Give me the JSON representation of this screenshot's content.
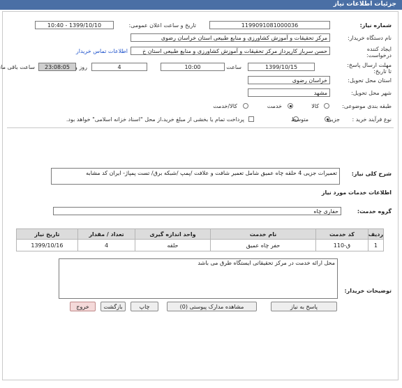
{
  "header": {
    "title": "جزئیات اطلاعات نیاز"
  },
  "need_number": {
    "label": "شماره نیاز:",
    "value": "1199091081000036"
  },
  "announce_datetime": {
    "label": "تاریخ و ساعت اعلان عمومی:",
    "value": "1399/10/10 - 10:40"
  },
  "buyer_org": {
    "label": "نام دستگاه خریدار:",
    "value": "مرکز تحقیقات و آموزش کشاورزی و منابع طبیعی استان خراسان رضوی"
  },
  "requester": {
    "label": "ایجاد کننده درخواست:",
    "value": "حسن  سرباز کارپرداز مرکز تحقیقات و آموزش کشاورزی و منابع طبیعی استان خ",
    "contact_link": "اطلاعات تماس خریدار"
  },
  "deadline": {
    "label": "مهلت ارسال پاسخ: تا تاریخ:",
    "date": "1399/10/15",
    "time_label": "ساعت",
    "time": "10:00",
    "days": "4",
    "days_label": "روز و",
    "remaining": "23:08:05",
    "remaining_label": "ساعت باقی مانده"
  },
  "delivery_province": {
    "label": "استان محل تحویل:",
    "value": "خراسان رضوی"
  },
  "delivery_city": {
    "label": "شهر محل تحویل:",
    "value": "مشهد"
  },
  "category": {
    "label": "طبقه بندی موضوعی:",
    "options": [
      "کالا",
      "خدمت",
      "کالا/خدمت"
    ],
    "selected": "خدمت"
  },
  "purchase_type": {
    "label": "نوع فرآیند خرید :",
    "options": [
      "جزیی",
      "متوسط"
    ],
    "selected": "جزیی",
    "note": "پرداخت تمام یا بخشی از مبلغ خرید،از محل \"اسناد خزانه اسلامی\" خواهد بود."
  },
  "description": {
    "label": "شرح کلی نیاز:",
    "value": "تعمیرات جزیی 4 حلقه چاه عمیق شامل تعمیر شافت و علافت /پمپ /شبکه برق/ تست پمپاژ- ایران کد مشابه"
  },
  "services_info": {
    "title": "اطلاعات خدمات مورد نیاز"
  },
  "service_group": {
    "label": "گروه خدمت:",
    "value": "حفاری چاه"
  },
  "table": {
    "headers": [
      "ردیف",
      "کد خدمت",
      "نام خدمت",
      "واحد اندازه گیری",
      "تعداد / مقدار",
      "تاریخ نیاز"
    ],
    "rows": [
      [
        "1",
        "ق-110",
        "حفر چاه عمیق",
        "حلقه",
        "4",
        "1399/10/16"
      ]
    ]
  },
  "buyer_notes": {
    "label": "توضیحات خریدار:",
    "value": "محل ارائه خدمت در مرکز تحقیقاتی ایستگاه طرق می باشد"
  },
  "buttons": {
    "reply": "پاسخ به نیاز",
    "docs": "مشاهده مدارک پیوستی (0)",
    "print": "چاپ",
    "back": "بازگشت",
    "exit": "خروج"
  },
  "colors": {
    "header_bg": "#4a6fa5",
    "link": "#2255cc",
    "remaining_bg": "#cfcfcf"
  }
}
